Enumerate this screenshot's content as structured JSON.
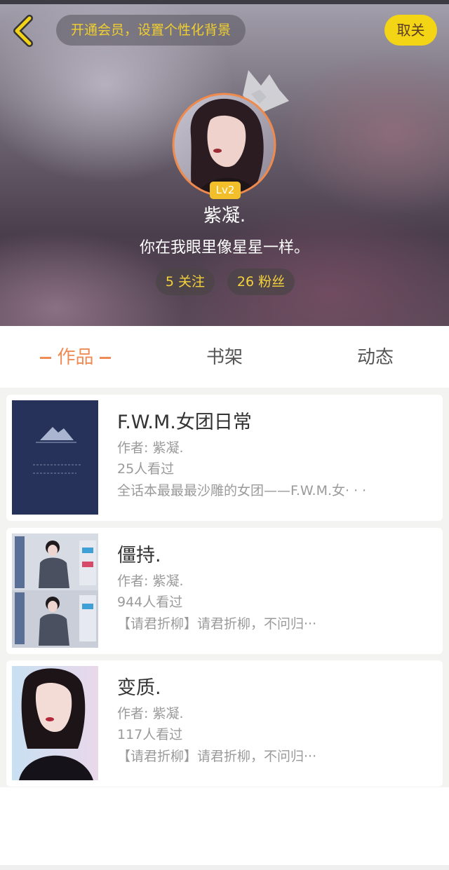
{
  "header": {
    "vip_banner": "开通会员，设置个性化背景",
    "unfollow_label": "取关",
    "level": "Lv2",
    "user_name": "紫凝.",
    "bio": "你在我眼里像星星一样。",
    "following": "5 关注",
    "fans": "26 粉丝"
  },
  "tabs": [
    {
      "label": "作品"
    },
    {
      "label": "书架"
    },
    {
      "label": "动态"
    }
  ],
  "books": [
    {
      "title": "F.W.M.女团日常",
      "author": "作者: 紫凝.",
      "views": "25人看过",
      "desc": "全话本最最最沙雕的女团——F.W.M.女· · ·"
    },
    {
      "title": "僵持.",
      "author": "作者: 紫凝.",
      "views": "944人看过",
      "desc": "【请君折柳】请君折柳，不问归···"
    },
    {
      "title": "变质.",
      "author": "作者: 紫凝.",
      "views": "117人看过",
      "desc": "【请君折柳】请君折柳，不问归···"
    }
  ],
  "colors": {
    "accent_orange": "#ef8b55",
    "vip_yellow": "#f4d516",
    "stat_yellow": "#f4d23a"
  },
  "icons": {
    "back": "back-chevron-icon",
    "crown": "crown-icon"
  }
}
